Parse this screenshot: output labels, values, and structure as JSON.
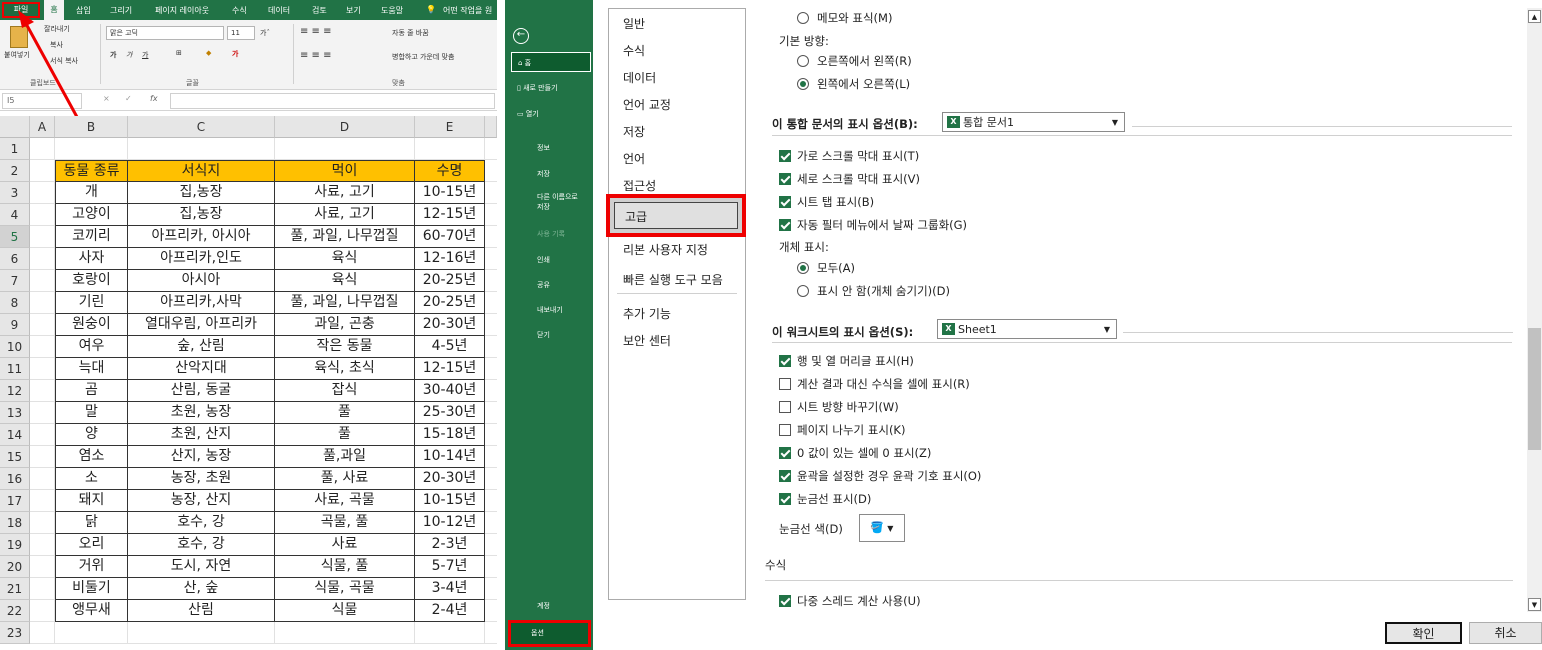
{
  "ribbon": {
    "tabs": [
      "파일",
      "홈",
      "삽입",
      "그리기",
      "페이지 레이아웃",
      "수식",
      "데이터",
      "검토",
      "보기",
      "도움말"
    ],
    "search": "어떤 작업을 원",
    "clipboard": {
      "paste": "붙여넣기",
      "cut": "잘라내기",
      "copy": "복사",
      "format_painter": "서식 복사",
      "label": "클립보드"
    },
    "font": {
      "name": "맑은 고딕",
      "size": "11",
      "bold": "가",
      "italic": "가",
      "underline": "가",
      "label": "글꼴"
    },
    "align": {
      "wrap": "자동 줄 바꿈",
      "merge": "병합하고 가운데 맞춤",
      "label": "맞춤"
    }
  },
  "formula_bar": {
    "name_box": "I5",
    "fx": "fx",
    "cancel": "×",
    "enter": "✓"
  },
  "grid": {
    "columns": [
      "A",
      "B",
      "C",
      "D",
      "E"
    ],
    "row_numbers": [
      "1",
      "2",
      "3",
      "4",
      "5",
      "6",
      "7",
      "8",
      "9",
      "10",
      "11",
      "12",
      "13",
      "14",
      "15",
      "16",
      "17",
      "18",
      "19",
      "20",
      "21",
      "22",
      "23"
    ],
    "header": [
      "동물 종류",
      "서식지",
      "먹이",
      "수명"
    ],
    "rows": [
      [
        "개",
        "집,농장",
        "사료, 고기",
        "10-15년"
      ],
      [
        "고양이",
        "집,농장",
        "사료, 고기",
        "12-15년"
      ],
      [
        "코끼리",
        "아프리카, 아시아",
        "풀, 과일, 나무껍질",
        "60-70년"
      ],
      [
        "사자",
        "아프리카,인도",
        "육식",
        "12-16년"
      ],
      [
        "호랑이",
        "아시아",
        "육식",
        "20-25년"
      ],
      [
        "기린",
        "아프리카,사막",
        "풀, 과일, 나무껍질",
        "20-25년"
      ],
      [
        "원숭이",
        "열대우림, 아프리카",
        "과일, 곤충",
        "20-30년"
      ],
      [
        "여우",
        "숲, 산림",
        "작은 동물",
        "4-5년"
      ],
      [
        "늑대",
        "산악지대",
        "육식, 초식",
        "12-15년"
      ],
      [
        "곰",
        "산림, 동굴",
        "잡식",
        "30-40년"
      ],
      [
        "말",
        "초원, 농장",
        "풀",
        "25-30년"
      ],
      [
        "양",
        "초원, 산지",
        "풀",
        "15-18년"
      ],
      [
        "염소",
        "산지, 농장",
        "풀,과일",
        "10-14년"
      ],
      [
        "소",
        "농장, 초원",
        "풀, 사료",
        "20-30년"
      ],
      [
        "돼지",
        "농장, 산지",
        "사료, 곡물",
        "10-15년"
      ],
      [
        "닭",
        "호수, 강",
        "곡물, 풀",
        "10-12년"
      ],
      [
        "오리",
        "호수, 강",
        "사료",
        "2-3년"
      ],
      [
        "거위",
        "도시, 자연",
        "식물, 풀",
        "5-7년"
      ],
      [
        "비둘기",
        "산, 숲",
        "식물, 곡물",
        "3-4년"
      ],
      [
        "앵무새",
        "산림",
        "식물",
        "2-4년"
      ]
    ]
  },
  "backstage": {
    "back": "←",
    "home": "홈",
    "new": "새로 만들기",
    "open": "열기",
    "info": "정보",
    "save": "저장",
    "save_as": "다른 이름으로 저장",
    "history": "사용 기록",
    "print": "인쇄",
    "share": "공유",
    "export": "내보내기",
    "close": "닫기",
    "account": "계정",
    "options": "옵션"
  },
  "options_nav": [
    "일반",
    "수식",
    "데이터",
    "언어 교정",
    "저장",
    "언어",
    "접근성",
    "고급",
    "리본 사용자 지정",
    "빠른 실행 도구 모음",
    "추가 기능",
    "보안 센터"
  ],
  "options": {
    "memo_indicator": "메모와 표식(M)",
    "default_direction_label": "기본 방향:",
    "rtl": "오른쪽에서 왼쪽(R)",
    "ltr": "왼쪽에서 오른쪽(L)",
    "workbook_section": "이 통합 문서의 표시 옵션(B):",
    "workbook_value": "통합 문서1",
    "show_hscroll": "가로 스크롤 막대 표시(T)",
    "show_vscroll": "세로 스크롤 막대 표시(V)",
    "show_sheet_tabs": "시트 탭 표시(B)",
    "group_dates": "자동 필터 메뉴에서 날짜 그룹화(G)",
    "objects_label": "개체 표시:",
    "objects_all": "모두(A)",
    "objects_none": "표시 안 함(개체 숨기기)(D)",
    "sheet_section": "이 워크시트의 표시 옵션(S):",
    "sheet_value": "Sheet1",
    "show_headers": "행 및 열 머리글 표시(H)",
    "show_formulas": "계산 결과 대신 수식을 셀에 표시(R)",
    "rtl_sheet": "시트 방향 바꾸기(W)",
    "page_breaks": "페이지 나누기 표시(K)",
    "show_zero": "0 값이 있는 셀에 0 표시(Z)",
    "outline_symbols": "윤곽을 설정한 경우 윤곽 기호 표시(O)",
    "gridlines": "눈금선 표시(D)",
    "gridline_color": "눈금선 색(D)",
    "formulas_section": "수식",
    "multithread": "다중 스레드 계산 사용(U)",
    "ok": "확인",
    "cancel": "취소"
  }
}
